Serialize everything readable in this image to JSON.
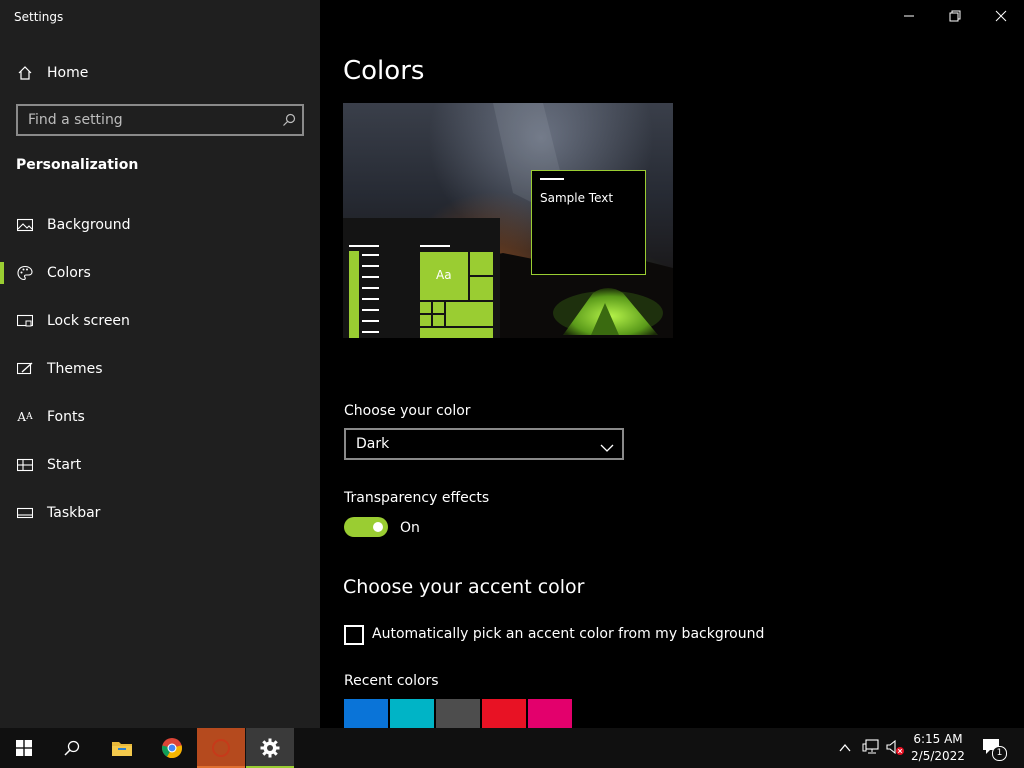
{
  "window": {
    "title": "Settings"
  },
  "sidebar": {
    "home_label": "Home",
    "search_placeholder": "Find a setting",
    "section_title": "Personalization",
    "items": [
      {
        "label": "Background",
        "icon": "image-icon"
      },
      {
        "label": "Colors",
        "icon": "palette-icon",
        "selected": true
      },
      {
        "label": "Lock screen",
        "icon": "lock-screen-icon"
      },
      {
        "label": "Themes",
        "icon": "themes-icon"
      },
      {
        "label": "Fonts",
        "icon": "fonts-icon"
      },
      {
        "label": "Start",
        "icon": "start-icon"
      },
      {
        "label": "Taskbar",
        "icon": "taskbar-icon"
      }
    ]
  },
  "main": {
    "page_title": "Colors",
    "preview": {
      "sample_text": "Sample Text",
      "tile_text": "Aa"
    },
    "choose_color": {
      "label": "Choose your color",
      "value": "Dark"
    },
    "transparency": {
      "label": "Transparency effects",
      "state_label": "On",
      "on": true
    },
    "accent": {
      "title": "Choose your accent color",
      "auto_checkbox_label": "Automatically pick an accent color from my background",
      "auto_checked": false,
      "recent_label": "Recent colors",
      "recent_colors": [
        "#0a74d8",
        "#00b4c6",
        "#4d4d4d",
        "#e81224",
        "#e3006c"
      ]
    }
  },
  "taskbar": {
    "time": "6:15 AM",
    "date": "2/5/2022",
    "notification_count": "1"
  },
  "colors": {
    "accent": "#9acd32",
    "sidebar_bg": "#1f1f1f",
    "main_bg": "#000000"
  }
}
